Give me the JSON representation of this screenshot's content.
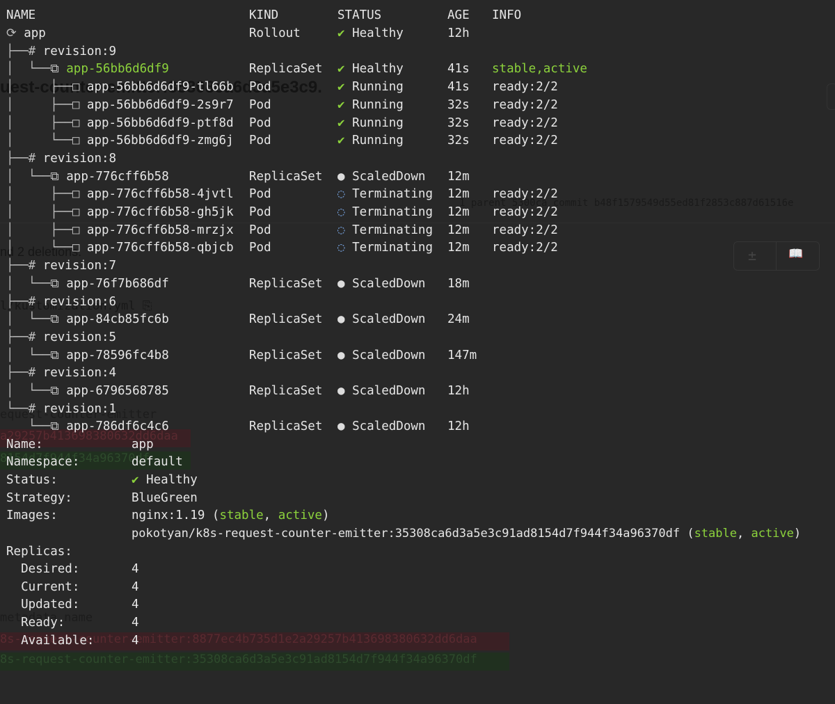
{
  "header": {
    "name": "NAME",
    "kind": "KIND",
    "status": "STATUS",
    "age": "AGE",
    "info": "INFO"
  },
  "tree": [
    {
      "prefix": "⟳ ",
      "name": "app",
      "name_color": "default",
      "kind": "Rollout",
      "status_icon": "✔",
      "status": "Healthy",
      "icon_color": "#8cd23c",
      "age": "12h",
      "info": ""
    },
    {
      "prefix": "├──# ",
      "name": "revision:9",
      "name_color": "default",
      "kind": "",
      "status_icon": "",
      "status": "",
      "age": "",
      "info": ""
    },
    {
      "prefix": "│  └──⧉ ",
      "name": "app-56bb6d6df9",
      "name_color": "green",
      "kind": "ReplicaSet",
      "status_icon": "✔",
      "status": "Healthy",
      "icon_color": "#8cd23c",
      "age": "41s",
      "info": "stable,active",
      "info_color": "green"
    },
    {
      "prefix": "│     ├──□ ",
      "name": "app-56bb6d6df9-tl66b",
      "name_color": "default",
      "kind": "Pod",
      "status_icon": "✔",
      "status": "Running",
      "icon_color": "#8cd23c",
      "age": "41s",
      "info": "ready:2/2"
    },
    {
      "prefix": "│     ├──□ ",
      "name": "app-56bb6d6df9-2s9r7",
      "name_color": "default",
      "kind": "Pod",
      "status_icon": "✔",
      "status": "Running",
      "icon_color": "#8cd23c",
      "age": "32s",
      "info": "ready:2/2"
    },
    {
      "prefix": "│     ├──□ ",
      "name": "app-56bb6d6df9-ptf8d",
      "name_color": "default",
      "kind": "Pod",
      "status_icon": "✔",
      "status": "Running",
      "icon_color": "#8cd23c",
      "age": "32s",
      "info": "ready:2/2"
    },
    {
      "prefix": "│     └──□ ",
      "name": "app-56bb6d6df9-zmg6j",
      "name_color": "default",
      "kind": "Pod",
      "status_icon": "✔",
      "status": "Running",
      "icon_color": "#8cd23c",
      "age": "32s",
      "info": "ready:2/2"
    },
    {
      "prefix": "├──# ",
      "name": "revision:8",
      "name_color": "default",
      "kind": "",
      "status_icon": "",
      "status": "",
      "age": "",
      "info": ""
    },
    {
      "prefix": "│  └──⧉ ",
      "name": "app-776cff6b58",
      "name_color": "default",
      "kind": "ReplicaSet",
      "status_icon": "●",
      "status": "ScaledDown",
      "icon_color": "#dcdcdc",
      "age": "12m",
      "info": ""
    },
    {
      "prefix": "│     ├──□ ",
      "name": "app-776cff6b58-4jvtl",
      "name_color": "default",
      "kind": "Pod",
      "status_icon": "◌",
      "status": "Terminating",
      "icon_color": "#7aa8e8",
      "age": "12m",
      "info": "ready:2/2"
    },
    {
      "prefix": "│     ├──□ ",
      "name": "app-776cff6b58-gh5jk",
      "name_color": "default",
      "kind": "Pod",
      "status_icon": "◌",
      "status": "Terminating",
      "icon_color": "#7aa8e8",
      "age": "12m",
      "info": "ready:2/2"
    },
    {
      "prefix": "│     ├──□ ",
      "name": "app-776cff6b58-mrzjx",
      "name_color": "default",
      "kind": "Pod",
      "status_icon": "◌",
      "status": "Terminating",
      "icon_color": "#7aa8e8",
      "age": "12m",
      "info": "ready:2/2"
    },
    {
      "prefix": "│     └──□ ",
      "name": "app-776cff6b58-qbjcb",
      "name_color": "default",
      "kind": "Pod",
      "status_icon": "◌",
      "status": "Terminating",
      "icon_color": "#7aa8e8",
      "age": "12m",
      "info": "ready:2/2"
    },
    {
      "prefix": "├──# ",
      "name": "revision:7",
      "name_color": "default",
      "kind": "",
      "status_icon": "",
      "status": "",
      "age": "",
      "info": ""
    },
    {
      "prefix": "│  └──⧉ ",
      "name": "app-76f7b686df",
      "name_color": "default",
      "kind": "ReplicaSet",
      "status_icon": "●",
      "status": "ScaledDown",
      "icon_color": "#dcdcdc",
      "age": "18m",
      "info": ""
    },
    {
      "prefix": "├──# ",
      "name": "revision:6",
      "name_color": "default",
      "kind": "",
      "status_icon": "",
      "status": "",
      "age": "",
      "info": ""
    },
    {
      "prefix": "│  └──⧉ ",
      "name": "app-84cb85fc6b",
      "name_color": "default",
      "kind": "ReplicaSet",
      "status_icon": "●",
      "status": "ScaledDown",
      "icon_color": "#dcdcdc",
      "age": "24m",
      "info": ""
    },
    {
      "prefix": "├──# ",
      "name": "revision:5",
      "name_color": "default",
      "kind": "",
      "status_icon": "",
      "status": "",
      "age": "",
      "info": ""
    },
    {
      "prefix": "│  └──⧉ ",
      "name": "app-78596fc4b8",
      "name_color": "default",
      "kind": "ReplicaSet",
      "status_icon": "●",
      "status": "ScaledDown",
      "icon_color": "#dcdcdc",
      "age": "147m",
      "info": ""
    },
    {
      "prefix": "├──# ",
      "name": "revision:4",
      "name_color": "default",
      "kind": "",
      "status_icon": "",
      "status": "",
      "age": "",
      "info": ""
    },
    {
      "prefix": "│  └──⧉ ",
      "name": "app-6796568785",
      "name_color": "default",
      "kind": "ReplicaSet",
      "status_icon": "●",
      "status": "ScaledDown",
      "icon_color": "#dcdcdc",
      "age": "12h",
      "info": ""
    },
    {
      "prefix": "└──# ",
      "name": "revision:1",
      "name_color": "default",
      "kind": "",
      "status_icon": "",
      "status": "",
      "age": "",
      "info": ""
    },
    {
      "prefix": "   └──⧉ ",
      "name": "app-786df6c4c6",
      "name_color": "default",
      "kind": "ReplicaSet",
      "status_icon": "●",
      "status": "ScaledDown",
      "icon_color": "#dcdcdc",
      "age": "12h",
      "info": ""
    }
  ],
  "details": {
    "name_label": "Name:",
    "name_value": "app",
    "namespace_label": "Namespace:",
    "namespace_value": "default",
    "status_label": "Status:",
    "status_icon": "✔",
    "status_value": "Healthy",
    "strategy_label": "Strategy:",
    "strategy_value": "BlueGreen",
    "images_label": "Images:",
    "image1_name": "nginx:1.19 (",
    "image1_tag1": "stable",
    "image1_sep": ", ",
    "image1_tag2": "active",
    "image1_end": ")",
    "image2_name": "pokotyan/k8s-request-counter-emitter:35308ca6d3a5e3c91ad8154d7f944f34a96370df (",
    "image2_tag1": "stable",
    "image2_sep": ", ",
    "image2_tag2": "active",
    "image2_end": ")",
    "replicas_label": "Replicas:",
    "desired_label": "  Desired:",
    "desired_value": "4",
    "current_label": "  Current:",
    "current_value": "4",
    "updated_label": "  Updated:",
    "updated_value": "4",
    "ready_label": "  Ready:",
    "ready_value": "4",
    "available_label": "  Available:",
    "available_value": "4"
  },
  "background": {
    "title": "uest-counter-emitter:35308ca6d3a5e3c9.",
    "commit": "1 parent 5300ca  commit b48f1579549d55ed81f2853c887d61516e",
    "deletions": "nd 2 deletions.",
    "file": "l/kustomization.yml  ⎘",
    "plus_icon": "±",
    "book_icon": "📖",
    "lines": [
      {
        "text": "equest-counter-emitter",
        "type": "neutral"
      },
      {
        "text": "a29257b413698380632dd6daa",
        "type": "del"
      },
      {
        "text": "8154d7f944f34a96370df",
        "type": "add"
      },
      {
        "text": "metadata.name",
        "type": "neutral"
      },
      {
        "text": "8s-request-counter-emitter:8877ec4b735d1e2a29257b413698380632dd6daa",
        "type": "del"
      },
      {
        "text": "8s-request-counter-emitter:35308ca6d3a5e3c91ad8154d7f944f34a96370df",
        "type": "add"
      }
    ]
  }
}
